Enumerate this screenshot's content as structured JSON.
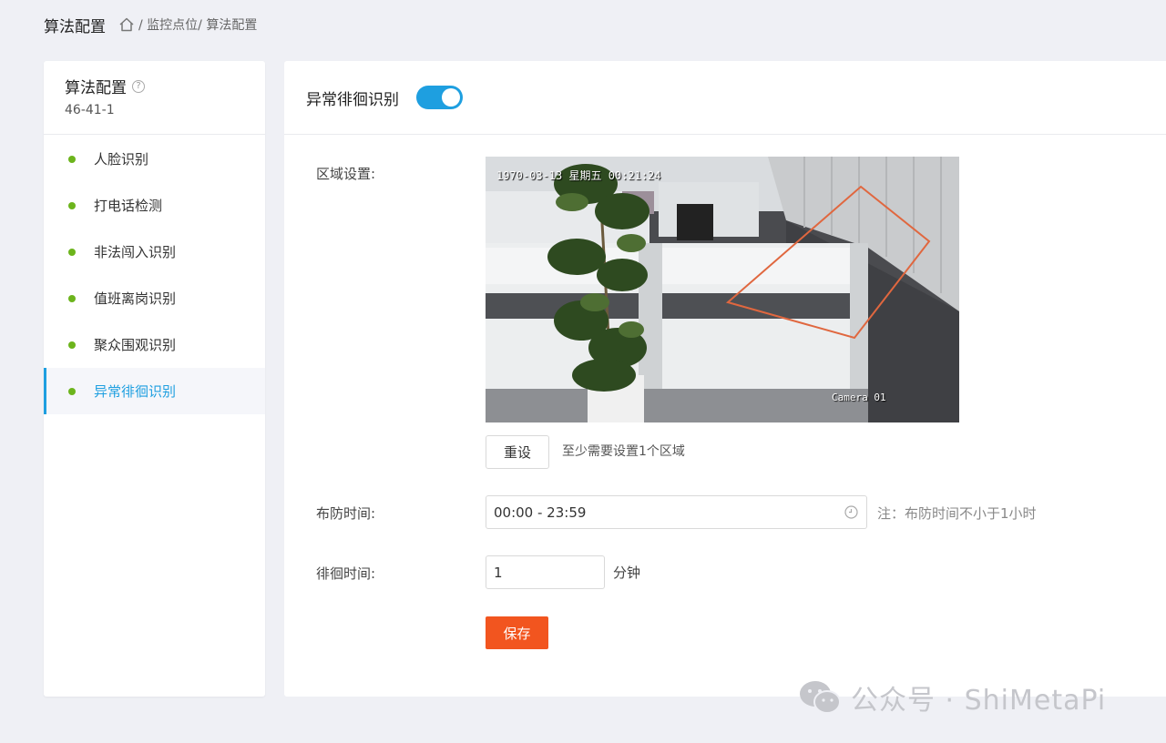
{
  "header": {
    "title": "算法配置",
    "breadcrumb": "/ 监控点位/ 算法配置"
  },
  "left_panel": {
    "title": "算法配置",
    "subtitle": "46-41-1",
    "items": [
      {
        "label": "人脸识别"
      },
      {
        "label": "打电话检测"
      },
      {
        "label": "非法闯入识别"
      },
      {
        "label": "值班离岗识别"
      },
      {
        "label": "聚众围观识别"
      },
      {
        "label": "异常徘徊识别"
      }
    ],
    "active_index": 5,
    "dot_color": "#6cb41c",
    "active_color": "#1e9fe0"
  },
  "main": {
    "title": "异常徘徊识别",
    "toggle_on": true,
    "area_label": "区域设置:",
    "camera": {
      "timestamp": "1970-03-13 星期五 00:21:24",
      "name": "Camera 01"
    },
    "reset_label": "重设",
    "reset_hint": "至少需要设置1个区域",
    "defense_label": "布防时间:",
    "defense_value": "00:00 - 23:59",
    "defense_note": "注：布防时间不小于1小时",
    "loiter_label": "徘徊时间:",
    "loiter_value": "1",
    "loiter_unit": "分钟",
    "save_label": "保存",
    "save_color": "#f2551f"
  },
  "watermark": {
    "text": "公众号 · ShiMetaPi"
  }
}
